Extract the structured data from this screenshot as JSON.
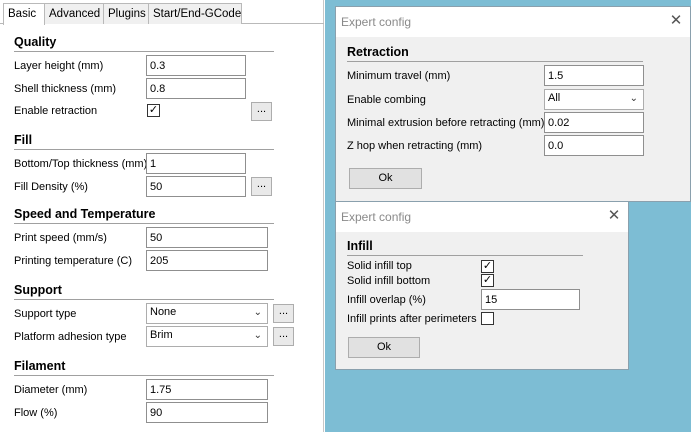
{
  "tabs": [
    "Basic",
    "Advanced",
    "Plugins",
    "Start/End-GCode"
  ],
  "quality": {
    "title": "Quality",
    "layer_height_label": "Layer height (mm)",
    "layer_height": "0.3",
    "shell_thickness_label": "Shell thickness (mm)",
    "shell_thickness": "0.8",
    "enable_retraction_label": "Enable retraction",
    "enable_retraction": true
  },
  "fill": {
    "title": "Fill",
    "bottom_top_label": "Bottom/Top thickness (mm)",
    "bottom_top": "1",
    "density_label": "Fill Density (%)",
    "density": "50"
  },
  "speed": {
    "title": "Speed and Temperature",
    "print_speed_label": "Print speed (mm/s)",
    "print_speed": "50",
    "print_temp_label": "Printing temperature (C)",
    "print_temp": "205"
  },
  "support": {
    "title": "Support",
    "type_label": "Support type",
    "type": "None",
    "adhesion_label": "Platform adhesion type",
    "adhesion": "Brim"
  },
  "filament": {
    "title": "Filament",
    "diameter_label": "Diameter (mm)",
    "diameter": "1.75",
    "flow_label": "Flow (%)",
    "flow": "90"
  },
  "ellipsis": "...",
  "retraction_dialog": {
    "title": "Expert config",
    "section": "Retraction",
    "min_travel_label": "Minimum travel (mm)",
    "min_travel": "1.5",
    "combing_label": "Enable combing",
    "combing": "All",
    "min_extrusion_label": "Minimal extrusion before retracting (mm)",
    "min_extrusion": "0.02",
    "zhop_label": "Z hop when retracting (mm)",
    "zhop": "0.0",
    "ok": "Ok"
  },
  "infill_dialog": {
    "title": "Expert config",
    "section": "Infill",
    "solid_top_label": "Solid infill top",
    "solid_top": true,
    "solid_bottom_label": "Solid infill bottom",
    "solid_bottom": true,
    "overlap_label": "Infill overlap (%)",
    "overlap": "15",
    "after_perimeters_label": "Infill prints after perimeters",
    "after_perimeters": false,
    "ok": "Ok"
  },
  "colors": {
    "desktop": "#7dbdd4",
    "dialog_bg": "#f0f0f0",
    "title_text": "#8a8a8a"
  }
}
